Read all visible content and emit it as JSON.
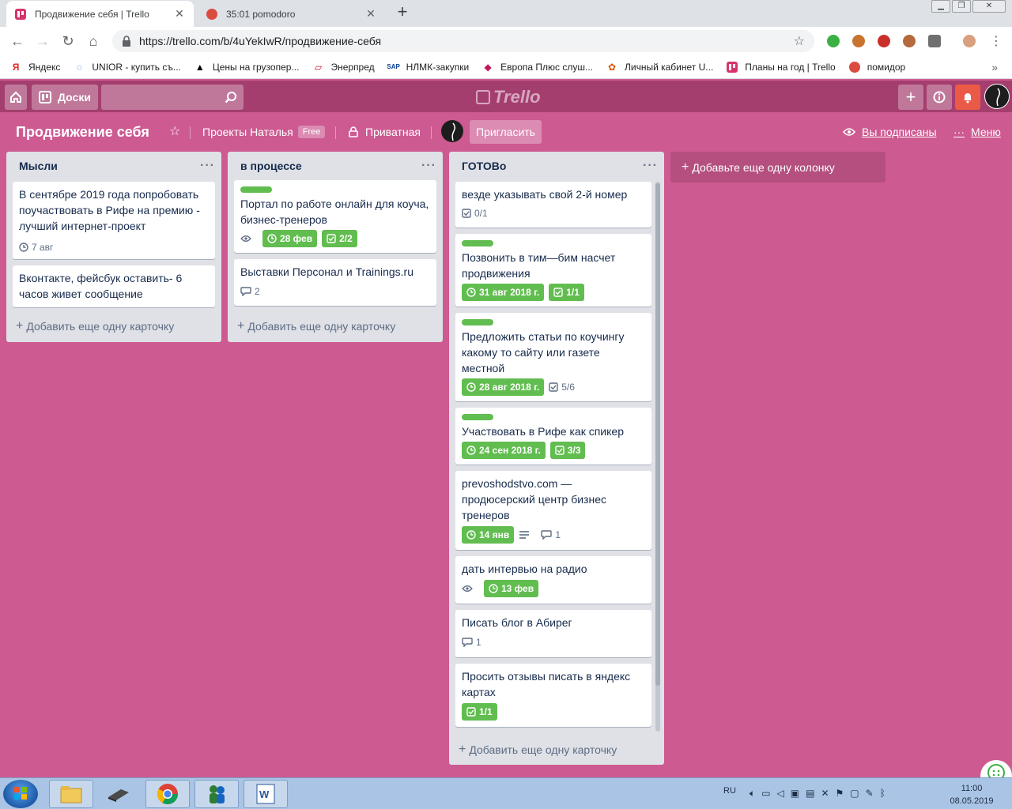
{
  "browser": {
    "tabs": [
      {
        "title": "Продвижение себя | Trello",
        "active": true
      },
      {
        "title": "35:01 pomodoro",
        "active": false
      }
    ],
    "url": "https://trello.com/b/4uYekIwR/продвижение-себя",
    "bookmarks": [
      {
        "label": "Яндекс",
        "icon": "yandex-icon"
      },
      {
        "label": "UNIOR - купить съ...",
        "icon": "unior-icon"
      },
      {
        "label": "Цены на грузопер...",
        "icon": "cargo-icon"
      },
      {
        "label": "Энерпред",
        "icon": "enerpred-icon"
      },
      {
        "label": "НЛМК-закупки",
        "icon": "sap-icon"
      },
      {
        "label": "Европа Плюс слуш...",
        "icon": "radio-icon"
      },
      {
        "label": "Личный кабинет U...",
        "icon": "cabinet-icon"
      },
      {
        "label": "Планы на год | Trello",
        "icon": "trello-icon"
      },
      {
        "label": "помидор",
        "icon": "pomodoro-icon"
      }
    ]
  },
  "trello": {
    "boards_label": "Доски",
    "logo": "Trello"
  },
  "board": {
    "title": "Продвижение себя",
    "team": "Проекты Наталья",
    "plan_badge": "Free",
    "visibility": "Приватная",
    "invite_label": "Пригласить",
    "watching_label": "Вы подписаны",
    "menu_label": "Меню",
    "add_list_label": "Добавьте еще одну колонку",
    "add_card_label": "Добавить еще одну карточку"
  },
  "lists": [
    {
      "title": "Мысли",
      "cards": [
        {
          "text": "В сентябре 2019 года попробовать поучаствовать в Рифе на премию - лучший интернет-проект",
          "due": "7 авг"
        },
        {
          "text": "Вконтакте, фейсбук оставить- 6 часов живет сообщение"
        }
      ]
    },
    {
      "title": "в процессе",
      "cards": [
        {
          "text": "Портал по работе онлайн для коуча, бизнес-тренеров",
          "due": "28 фев",
          "checklist": "2/2"
        },
        {
          "text": "Выставки Персонал и Trainings.ru",
          "comments": "2"
        }
      ]
    },
    {
      "title": "ГОТОВо",
      "cards": [
        {
          "text": "везде указывать свой 2-й номер",
          "checklist": "0/1"
        },
        {
          "text": "Позвонить в тим—бим насчет продвижения",
          "due": "31 авг 2018 г.",
          "checklist": "1/1"
        },
        {
          "text": "Предложить статьи по коучингу какому то сайту или газете местной",
          "due": "28 авг 2018 г.",
          "checklist": "5/6"
        },
        {
          "text": "Участвовать в Рифе как спикер",
          "due": "24 сен 2018 г.",
          "checklist": "3/3"
        },
        {
          "text": "prevoshodstvo.com — продюсерский центр бизнес тренеров",
          "due": "14 янв",
          "comments": "1"
        },
        {
          "text": "дать интервью на радио",
          "due": "13 фев"
        },
        {
          "text": "Писать блог в Абирег",
          "comments": "1"
        },
        {
          "text": "Просить отзывы писать в яндекс картах",
          "checklist": "1/1"
        }
      ]
    }
  ],
  "taskbar": {
    "lang": "RU",
    "time": "11:00",
    "date": "08.05.2019"
  },
  "colors": {
    "board_bg": "#cd5a91",
    "header_bg": "#a43e6f",
    "label_green": "#61bd4f",
    "notification_orange": "#eb5a46"
  }
}
